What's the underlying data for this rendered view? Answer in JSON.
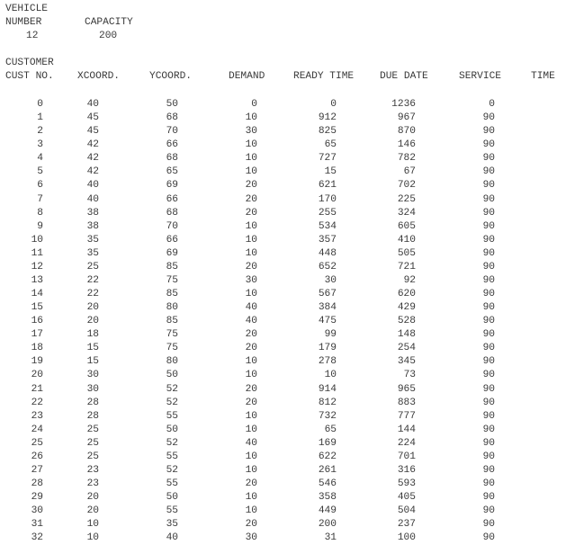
{
  "vehicle": {
    "section_label": "VEHICLE",
    "number_label": "NUMBER",
    "capacity_label": "CAPACITY",
    "number_value": "12",
    "capacity_value": "200"
  },
  "customer": {
    "section_label": "CUSTOMER",
    "headers": [
      "CUST NO.",
      "XCOORD.",
      "YCOORD.",
      "DEMAND",
      "READY TIME",
      "DUE DATE",
      "SERVICE",
      "TIME"
    ],
    "rows": [
      [
        "0",
        "40",
        "50",
        "0",
        "0",
        "1236",
        "0"
      ],
      [
        "1",
        "45",
        "68",
        "10",
        "912",
        "967",
        "90"
      ],
      [
        "2",
        "45",
        "70",
        "30",
        "825",
        "870",
        "90"
      ],
      [
        "3",
        "42",
        "66",
        "10",
        "65",
        "146",
        "90"
      ],
      [
        "4",
        "42",
        "68",
        "10",
        "727",
        "782",
        "90"
      ],
      [
        "5",
        "42",
        "65",
        "10",
        "15",
        "67",
        "90"
      ],
      [
        "6",
        "40",
        "69",
        "20",
        "621",
        "702",
        "90"
      ],
      [
        "7",
        "40",
        "66",
        "20",
        "170",
        "225",
        "90"
      ],
      [
        "8",
        "38",
        "68",
        "20",
        "255",
        "324",
        "90"
      ],
      [
        "9",
        "38",
        "70",
        "10",
        "534",
        "605",
        "90"
      ],
      [
        "10",
        "35",
        "66",
        "10",
        "357",
        "410",
        "90"
      ],
      [
        "11",
        "35",
        "69",
        "10",
        "448",
        "505",
        "90"
      ],
      [
        "12",
        "25",
        "85",
        "20",
        "652",
        "721",
        "90"
      ],
      [
        "13",
        "22",
        "75",
        "30",
        "30",
        "92",
        "90"
      ],
      [
        "14",
        "22",
        "85",
        "10",
        "567",
        "620",
        "90"
      ],
      [
        "15",
        "20",
        "80",
        "40",
        "384",
        "429",
        "90"
      ],
      [
        "16",
        "20",
        "85",
        "40",
        "475",
        "528",
        "90"
      ],
      [
        "17",
        "18",
        "75",
        "20",
        "99",
        "148",
        "90"
      ],
      [
        "18",
        "15",
        "75",
        "20",
        "179",
        "254",
        "90"
      ],
      [
        "19",
        "15",
        "80",
        "10",
        "278",
        "345",
        "90"
      ],
      [
        "20",
        "30",
        "50",
        "10",
        "10",
        "73",
        "90"
      ],
      [
        "21",
        "30",
        "52",
        "20",
        "914",
        "965",
        "90"
      ],
      [
        "22",
        "28",
        "52",
        "20",
        "812",
        "883",
        "90"
      ],
      [
        "23",
        "28",
        "55",
        "10",
        "732",
        "777",
        "90"
      ],
      [
        "24",
        "25",
        "50",
        "10",
        "65",
        "144",
        "90"
      ],
      [
        "25",
        "25",
        "52",
        "40",
        "169",
        "224",
        "90"
      ],
      [
        "26",
        "25",
        "55",
        "10",
        "622",
        "701",
        "90"
      ],
      [
        "27",
        "23",
        "52",
        "10",
        "261",
        "316",
        "90"
      ],
      [
        "28",
        "23",
        "55",
        "20",
        "546",
        "593",
        "90"
      ],
      [
        "29",
        "20",
        "50",
        "10",
        "358",
        "405",
        "90"
      ],
      [
        "30",
        "20",
        "55",
        "10",
        "449",
        "504",
        "90"
      ],
      [
        "31",
        "10",
        "35",
        "20",
        "200",
        "237",
        "90"
      ],
      [
        "32",
        "10",
        "40",
        "30",
        "31",
        "100",
        "90"
      ]
    ]
  }
}
